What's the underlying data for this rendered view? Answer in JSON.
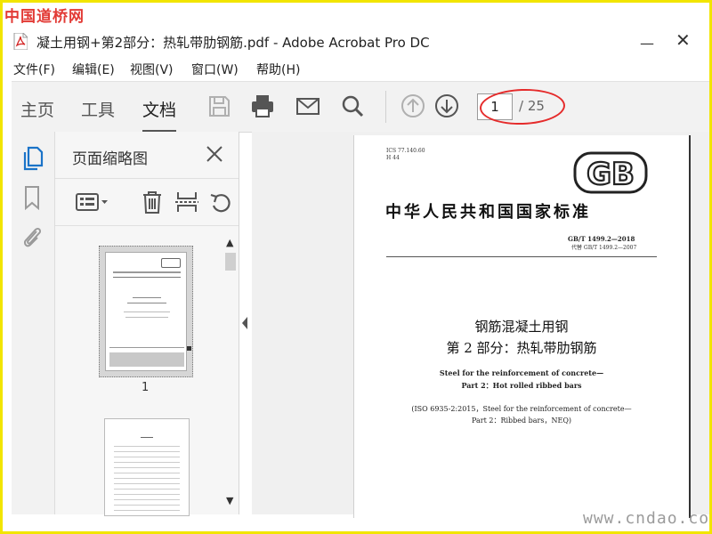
{
  "watermark_top": "中国道桥网",
  "watermark_bottom": "www.cndao.com",
  "window": {
    "title": "凝土用钢+第2部分：热轧带肋钢筋.pdf - Adobe Acrobat Pro DC",
    "minimize_glyph": "—",
    "close_glyph": "✕"
  },
  "menu": [
    "文件(F)",
    "编辑(E)",
    "视图(V)",
    "窗口(W)",
    "帮助(H)"
  ],
  "toolbar": {
    "tabs": [
      {
        "label": "主页",
        "active": false
      },
      {
        "label": "工具",
        "active": false
      },
      {
        "label": "文档",
        "active": true
      }
    ],
    "icons": [
      "save-icon",
      "print-icon",
      "email-icon",
      "search-icon",
      "page-up-icon",
      "page-down-icon"
    ],
    "current_page": "1",
    "total_pages": "/ 25",
    "highlight_color": "#e52b2b"
  },
  "left_rail": {
    "icons": [
      "page-thumbnails-icon",
      "bookmark-icon",
      "attachment-icon"
    ],
    "active_color": "#1a73c8"
  },
  "thumbnails_panel": {
    "title": "页面缩略图",
    "tools": [
      "thumbnail-options-icon",
      "delete-page-icon",
      "extract-page-icon",
      "rotate-page-icon"
    ],
    "thumb1_label": "1"
  },
  "document": {
    "ics_line1": "ICS 77.140.60",
    "ics_line2": "H 44",
    "logo_text": "GB",
    "standard_title": "中华人民共和国国家标准",
    "standard_number": "GB/T 1499.2—2018",
    "replaces": "代替 GB/T 1499.2—2007",
    "title_cn_1": "钢筋混凝土用钢",
    "title_cn_2": "第 2 部分：热轧带肋钢筋",
    "title_en_1": "Steel for the reinforcement of concrete—",
    "title_en_2": "Part 2：Hot rolled ribbed bars",
    "iso_1": "(ISO 6935-2:2015，Steel for the reinforcement of concrete—",
    "iso_2": "Part 2：Ribbed bars，NEQ)"
  }
}
